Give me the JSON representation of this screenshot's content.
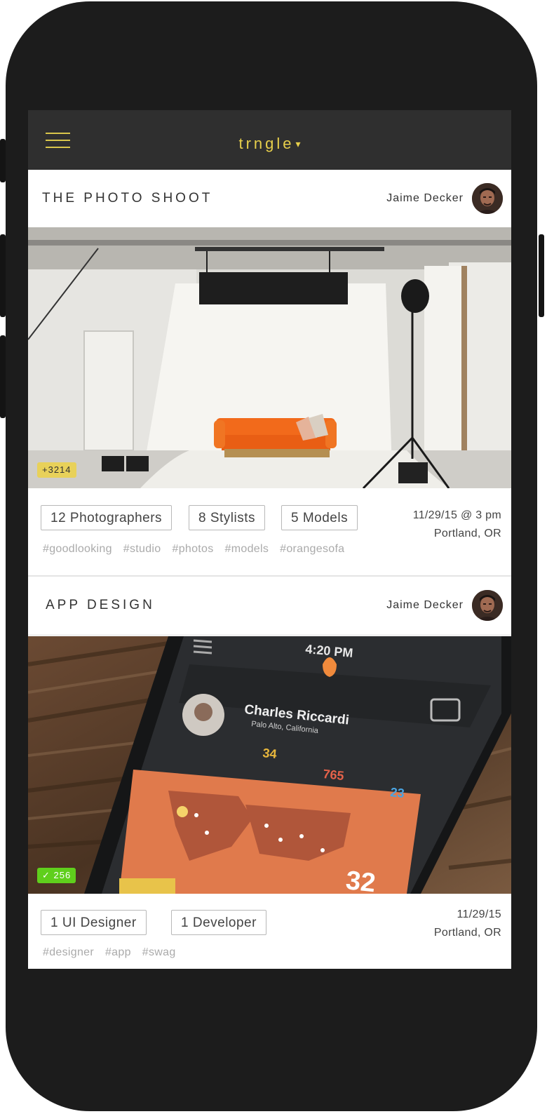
{
  "header": {
    "brand": "trngle",
    "caret": "▾",
    "menu_icon": "hamburger-icon"
  },
  "posts": [
    {
      "title": "THE PHOTO SHOOT",
      "author": "Jaime Decker",
      "badge": "+3214",
      "badge_color": "#e8d15a",
      "roles": [
        "12 Photographers",
        "8 Stylists",
        "5 Models"
      ],
      "date": "11/29/15 @ 3 pm",
      "location": "Portland, OR",
      "tags": [
        "#goodlooking",
        "#studio",
        "#photos",
        "#models",
        "#orangesofa"
      ]
    },
    {
      "title": "APP DESIGN",
      "author": "Jaime Decker",
      "badge": "256",
      "badge_icon": "checkmark-icon",
      "badge_color": "#5fcf1c",
      "roles": [
        "1 UI Designer",
        "1 Developer"
      ],
      "date": "11/29/15",
      "location": "Portland, OR",
      "tags": [
        "#designer",
        "#app",
        "#swag"
      ],
      "image_text": {
        "time": "4:20 PM",
        "name": "Charles Riccardi",
        "place": "Palo Alto, California",
        "stat_1": "34",
        "stat_2": "765",
        "stat_3": "23",
        "big_number": "32"
      }
    }
  ]
}
